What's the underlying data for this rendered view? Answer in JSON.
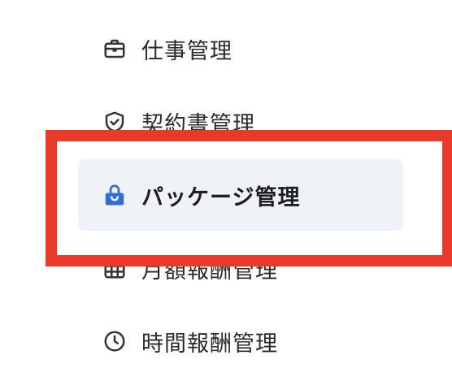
{
  "colors": {
    "highlight": "#e8392a",
    "active_background": "#eff2f7",
    "active_icon": "#2f6fd6",
    "icon": "#333333"
  },
  "menu": {
    "items": [
      {
        "label": "仕事管理",
        "icon": "briefcase-icon",
        "active": false
      },
      {
        "label": "契約書管理",
        "icon": "shield-check-icon",
        "active": false
      },
      {
        "label": "パッケージ管理",
        "icon": "shopping-bag-icon",
        "active": true
      },
      {
        "label": "月額報酬管理",
        "icon": "calendar-icon",
        "active": false
      },
      {
        "label": "時間報酬管理",
        "icon": "clock-icon",
        "active": false
      }
    ]
  }
}
